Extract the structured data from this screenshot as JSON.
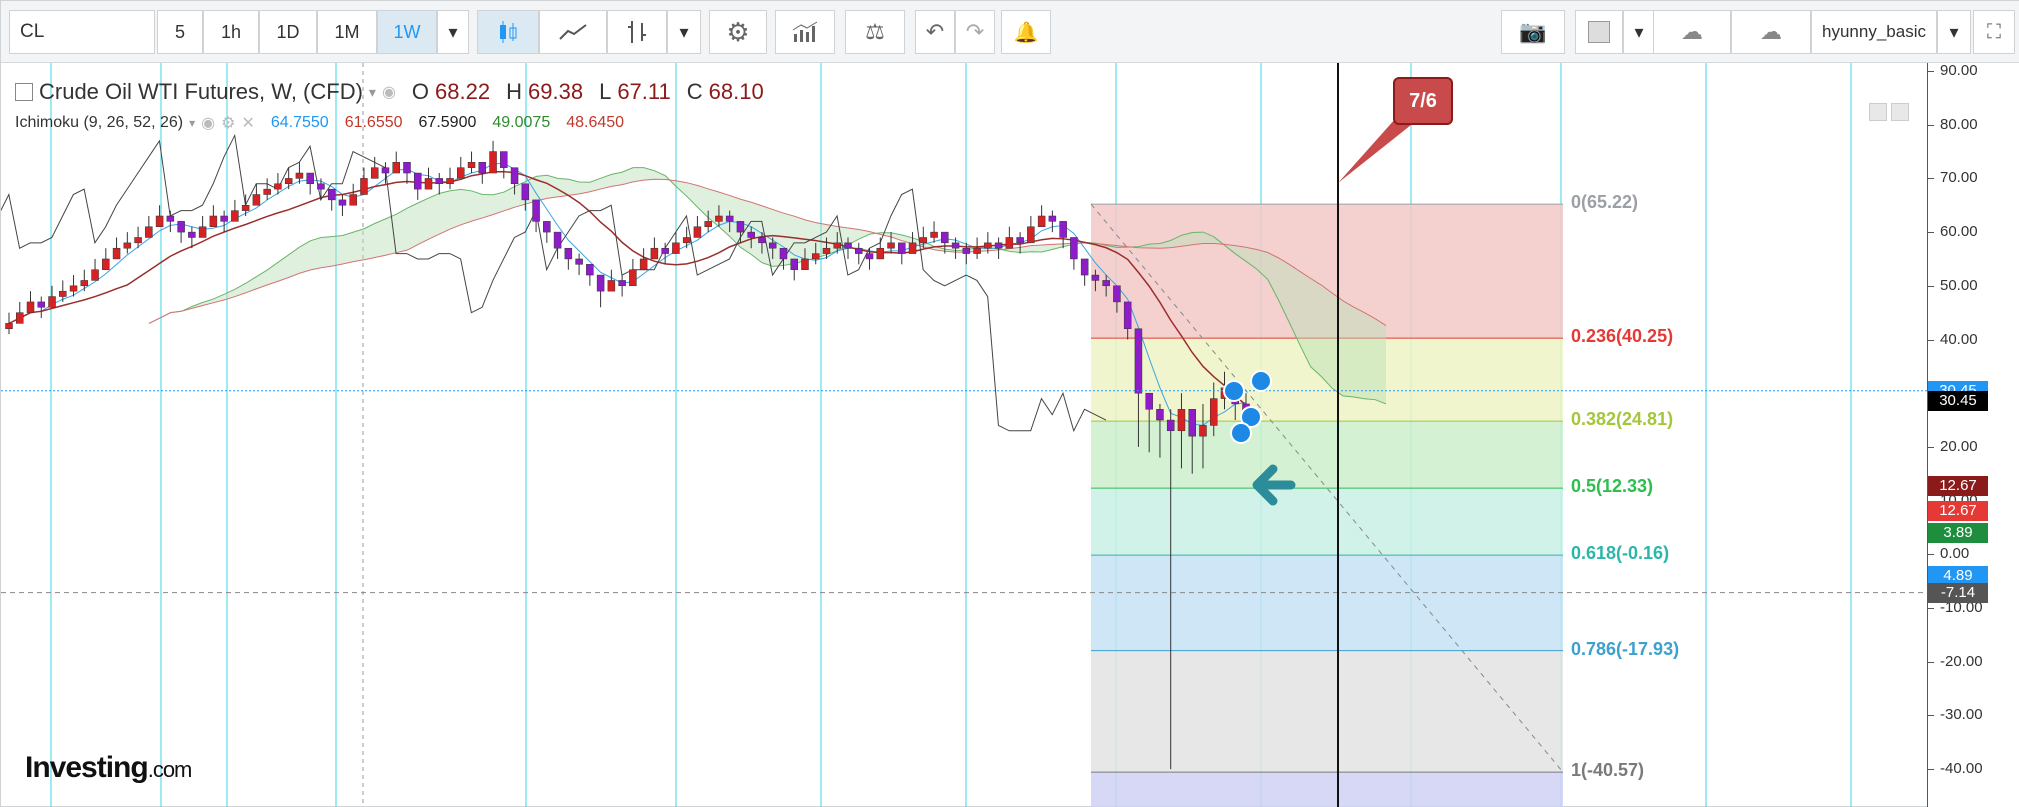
{
  "toolbar": {
    "symbol": "CL",
    "intervals": [
      "5",
      "1h",
      "1D",
      "1M",
      "1W"
    ],
    "active_interval": "1W",
    "user": "hyunny_basic",
    "icons": [
      "candles-icon",
      "line-chart-icon",
      "bar-chart-icon",
      "settings-icon",
      "indicators-icon",
      "compare-icon",
      "undo-icon",
      "redo-icon",
      "alert-icon",
      "camera-icon",
      "color-icon",
      "cloud-download-icon",
      "cloud-upload-icon",
      "fullscreen-icon"
    ]
  },
  "legend": {
    "title": "Crude Oil WTI Futures, W, (CFD)",
    "open_label": "O",
    "open": "68.22",
    "high_label": "H",
    "high": "69.38",
    "low_label": "L",
    "low": "67.11",
    "close_label": "C",
    "close": "68.10",
    "indicator": "Ichimoku (9, 26, 52, 26)",
    "ichimoku_values": [
      "64.7550",
      "61.6550",
      "67.5900",
      "49.0075",
      "48.6450"
    ],
    "ichimoku_colors": [
      "#2196f3",
      "#c0392b",
      "#222222",
      "#2e8b2e",
      "#c0392b"
    ]
  },
  "price_axis": {
    "ticks": [
      "90.00",
      "80.00",
      "70.00",
      "60.00",
      "50.00",
      "40.00",
      "30.00",
      "20.00",
      "10.00",
      "0.00",
      "-10.00",
      "-20.00",
      "-30.00",
      "-40.00"
    ],
    "badges": [
      {
        "text": "30.45",
        "color": "#2196f3",
        "value": 30.45
      },
      {
        "text": "30.45",
        "color": "#000000",
        "value": 28.5
      },
      {
        "text": "12.67",
        "color": "#8b1a1a",
        "value": 12.67
      },
      {
        "text": "12.67",
        "color": "#e53935",
        "value": 8.0
      },
      {
        "text": "3.89",
        "color": "#1e8e3e",
        "value": 3.89
      },
      {
        "text": "4.89",
        "color": "#2196f3",
        "value": -4.0
      },
      {
        "text": "-7.14",
        "color": "#555555",
        "value": -7.14
      }
    ]
  },
  "fibonacci": [
    {
      "label": "0(65.22)",
      "value": 65.22,
      "color": "#9aa0a6",
      "fill": "#f2c9c7"
    },
    {
      "label": "0.236(40.25)",
      "value": 40.25,
      "color": "#e53935",
      "fill": "#eef3c6"
    },
    {
      "label": "0.382(24.81)",
      "value": 24.81,
      "color": "#a4c639",
      "fill": "#cdeecb"
    },
    {
      "label": "0.5(12.33)",
      "value": 12.33,
      "color": "#2ebd4e",
      "fill": "#c9f0e4"
    },
    {
      "label": "0.618(-0.16)",
      "value": -0.16,
      "color": "#2ab7a9",
      "fill": "#c6e2f3"
    },
    {
      "label": "0.786(-17.93)",
      "value": -17.93,
      "color": "#3ca0d0",
      "fill": "#e3e3e3"
    },
    {
      "label": "1(-40.57)",
      "value": -40.57,
      "color": "#7a7a7a",
      "fill": "#cfd1f3"
    }
  ],
  "date_flag": "7/6",
  "watermark": {
    "brand": "Investing",
    "suffix": ".com"
  },
  "chart_data": {
    "type": "candlestick",
    "title": "Crude Oil WTI Futures, W, (CFD)",
    "ylim": [
      -45,
      92
    ],
    "ohlc_last": {
      "open": 68.22,
      "high": 69.38,
      "low": 67.11,
      "close": 68.1
    },
    "closes": [
      43,
      45,
      47,
      46,
      48,
      49,
      50,
      51,
      53,
      55,
      57,
      58,
      59,
      61,
      63,
      62,
      60,
      59,
      61,
      63,
      62,
      64,
      65,
      67,
      68,
      69,
      70,
      71,
      69,
      68,
      66,
      65,
      67,
      70,
      72,
      71,
      73,
      71,
      68,
      70,
      69,
      70,
      72,
      73,
      71,
      75,
      72,
      69,
      66,
      62,
      60,
      57,
      55,
      54,
      52,
      49,
      51,
      50,
      53,
      55,
      57,
      56,
      58,
      59,
      61,
      62,
      63,
      62,
      60,
      59,
      58,
      57,
      55,
      53,
      55,
      56,
      57,
      58,
      57,
      56,
      55,
      57,
      58,
      56,
      58,
      59,
      60,
      58,
      57,
      56,
      57,
      58,
      57,
      59,
      58,
      61,
      63,
      62,
      59,
      55,
      52,
      51,
      50,
      47,
      42,
      30,
      27,
      25,
      23,
      27,
      22,
      24,
      29,
      31,
      28,
      25
    ],
    "highs": [
      45,
      47,
      49,
      48,
      50,
      51,
      52,
      53,
      55,
      57,
      59,
      60,
      61,
      63,
      65,
      64,
      62,
      61,
      63,
      65,
      64,
      66,
      67,
      69,
      70,
      71,
      72,
      73,
      71,
      70,
      68,
      67,
      69,
      72,
      74,
      73,
      75,
      73,
      70,
      72,
      71,
      72,
      74,
      75,
      73,
      77,
      74,
      71,
      68,
      64,
      62,
      59,
      57,
      56,
      54,
      51,
      53,
      52,
      55,
      57,
      59,
      58,
      60,
      61,
      63,
      64,
      65,
      64,
      62,
      61,
      60,
      59,
      57,
      55,
      57,
      58,
      59,
      60,
      59,
      58,
      57,
      59,
      60,
      58,
      60,
      61,
      62,
      60,
      59,
      58,
      59,
      60,
      59,
      61,
      60,
      63,
      65,
      64,
      61,
      57,
      54,
      53,
      52,
      49,
      44,
      36,
      30,
      28,
      27,
      30,
      26,
      28,
      32,
      34,
      31,
      30
    ],
    "lows": [
      41,
      43,
      45,
      44,
      46,
      47,
      48,
      49,
      51,
      53,
      55,
      56,
      57,
      59,
      61,
      60,
      58,
      57,
      59,
      61,
      60,
      62,
      63,
      65,
      66,
      67,
      68,
      69,
      67,
      66,
      64,
      63,
      65,
      68,
      70,
      69,
      71,
      69,
      66,
      68,
      67,
      68,
      70,
      71,
      69,
      73,
      70,
      67,
      64,
      60,
      58,
      55,
      53,
      52,
      50,
      46,
      49,
      48,
      51,
      53,
      55,
      54,
      56,
      57,
      59,
      60,
      61,
      60,
      58,
      57,
      56,
      55,
      53,
      51,
      53,
      54,
      55,
      56,
      55,
      54,
      53,
      55,
      56,
      54,
      56,
      57,
      58,
      56,
      55,
      54,
      55,
      56,
      55,
      57,
      56,
      59,
      61,
      60,
      57,
      53,
      50,
      49,
      48,
      45,
      40,
      20,
      19,
      18,
      -40,
      16,
      15,
      16,
      22,
      27,
      25,
      23
    ]
  }
}
